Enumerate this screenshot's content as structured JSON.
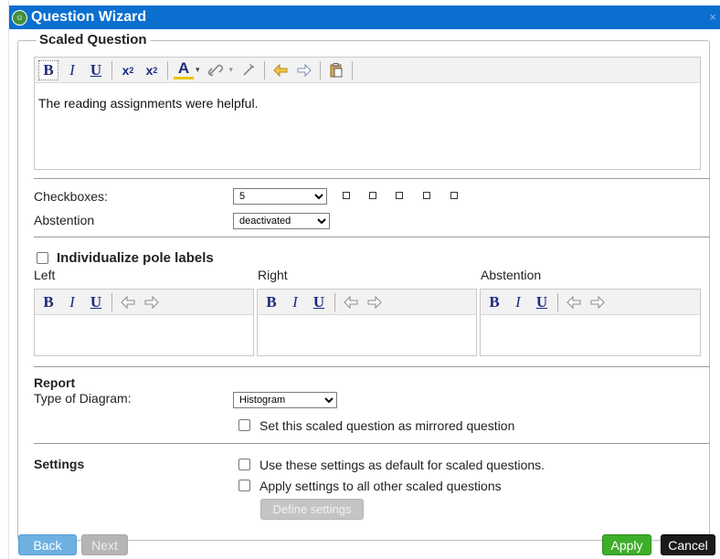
{
  "window": {
    "title": "Question Wizard",
    "close_glyph": "×",
    "logo_icon": "app-logo-icon"
  },
  "question": {
    "legend": "Scaled Question",
    "toolbar": {
      "bold": "B",
      "italic": "I",
      "underline": "U",
      "subscript": "x",
      "sub_index": "2",
      "superscript": "x",
      "sup_index": "2",
      "font_color": "A",
      "caret": "▾"
    },
    "text": "The reading assignments were helpful."
  },
  "scale": {
    "checkboxes_label": "Checkboxes:",
    "checkboxes_value": "5",
    "checkboxes_options": [
      "5"
    ],
    "abstention_label": "Abstention",
    "abstention_value": "deactivated",
    "abstention_options": [
      "deactivated"
    ]
  },
  "poles": {
    "individualize_label": "Individualize pole labels",
    "individualize_checked": false,
    "left_label": "Left",
    "right_label": "Right",
    "abstention_label": "Abstention",
    "toolbar": {
      "bold": "B",
      "italic": "I",
      "underline": "U"
    }
  },
  "report": {
    "heading": "Report",
    "diagram_label": "Type of Diagram:",
    "diagram_value": "Histogram",
    "diagram_options": [
      "Histogram"
    ],
    "mirrored_label": "Set this scaled question as mirrored question"
  },
  "settings": {
    "heading": "Settings",
    "default_label": "Use these settings as default for scaled questions.",
    "apply_all_label": "Apply settings to all other scaled questions",
    "define_button": "Define settings"
  },
  "footer": {
    "back": "Back",
    "next": "Next",
    "apply": "Apply",
    "cancel": "Cancel"
  },
  "colors": {
    "titlebar": "#0b6fd0",
    "apply": "#3fae2a",
    "back": "#6fb0e2",
    "cancel": "#1a1a1a",
    "toolbar_icon": "#1d2b7d"
  }
}
